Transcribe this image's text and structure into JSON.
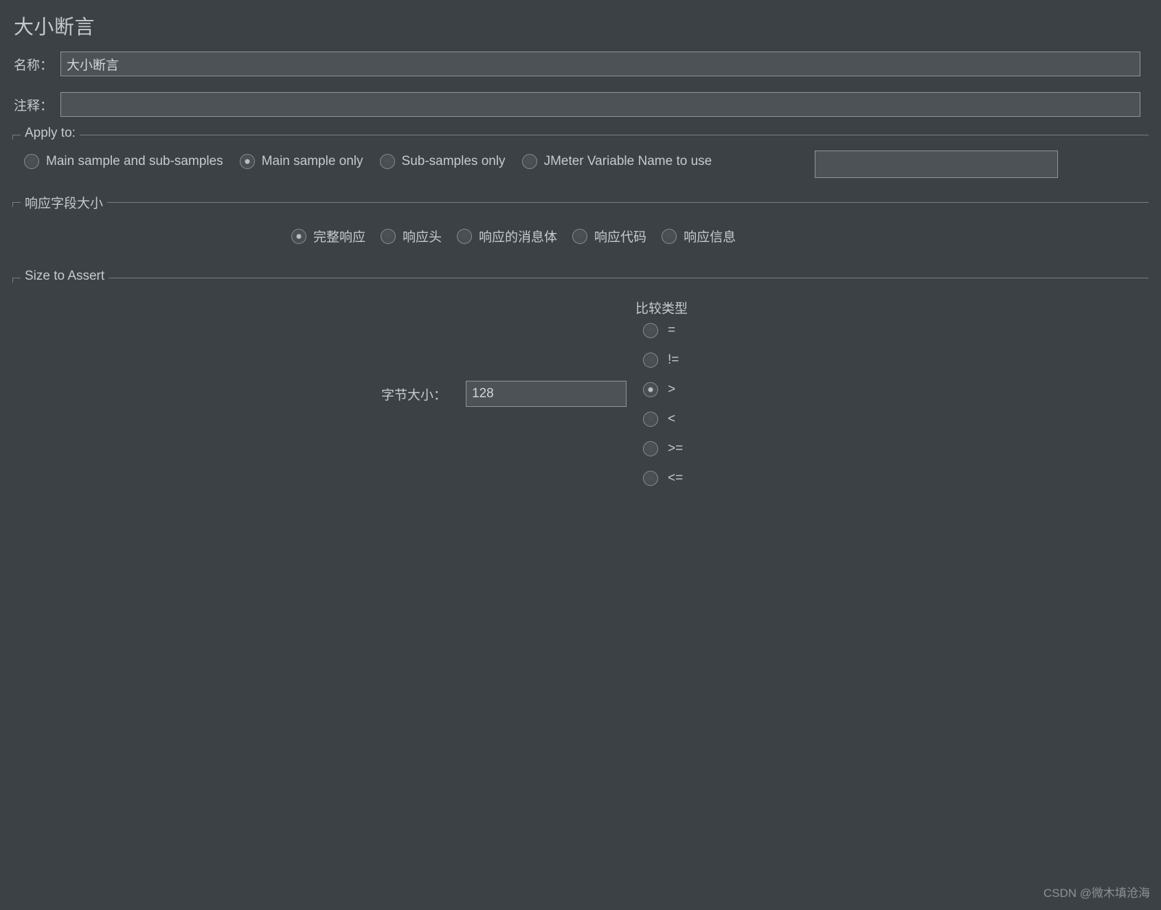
{
  "page": {
    "title": "大小断言",
    "background_color": "#3c4145",
    "text_color": "#c6cacd"
  },
  "name_row": {
    "label": "名称：",
    "value": "大小断言",
    "placeholder": ""
  },
  "comment_row": {
    "label": "注释：",
    "value": "",
    "placeholder": ""
  },
  "apply_to": {
    "legend": "Apply to:",
    "options": [
      {
        "label": "Main sample and sub-samples",
        "checked": false
      },
      {
        "label": "Main sample only",
        "checked": true
      },
      {
        "label": "Sub-samples only",
        "checked": false
      },
      {
        "label": "JMeter Variable Name to use",
        "checked": false
      }
    ],
    "variable_input": {
      "value": "",
      "placeholder": ""
    }
  },
  "response_field_size": {
    "legend": "响应字段大小",
    "options": [
      {
        "label": "完整响应",
        "checked": true
      },
      {
        "label": "响应头",
        "checked": false
      },
      {
        "label": "响应的消息体",
        "checked": false
      },
      {
        "label": "响应代码",
        "checked": false
      },
      {
        "label": "响应信息",
        "checked": false
      }
    ]
  },
  "size_to_assert": {
    "legend": "Size to Assert",
    "byte_size": {
      "label": "字节大小：",
      "value": "128",
      "placeholder": ""
    },
    "comparison": {
      "title": "比较类型",
      "options": [
        {
          "label": "=",
          "checked": false
        },
        {
          "label": "!=",
          "checked": false
        },
        {
          "label": ">",
          "checked": true
        },
        {
          "label": "<",
          "checked": false
        },
        {
          "label": ">=",
          "checked": false
        },
        {
          "label": "<=",
          "checked": false
        }
      ]
    }
  },
  "watermark": {
    "text": "CSDN @微木填沧海"
  }
}
